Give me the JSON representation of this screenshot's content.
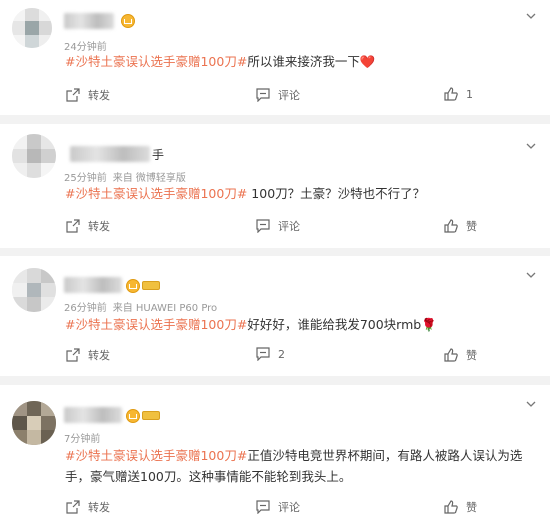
{
  "colors": {
    "topic": "#eb7350",
    "text": "#333333",
    "meta": "#999999",
    "card": "#ffffff",
    "background": "#f2f2f2"
  },
  "comments": [
    {
      "meta": "24分钟前",
      "source": "",
      "topic": "#沙特土豪误认选手豪赠100刀#",
      "text": "所以谁来接济我一下",
      "emoji": "❤️",
      "repost": "转发",
      "comment": "评论",
      "like": "1"
    },
    {
      "meta": "25分钟前",
      "source": "来自 微博轻享版",
      "topic": "#沙特土豪误认选手豪赠100刀#",
      "text": " 100刀？土豪？沙特也不行了？",
      "emoji": "",
      "repost": "转发",
      "comment": "评论",
      "like": "赞"
    },
    {
      "meta": "26分钟前",
      "source": "来自 HUAWEI P60 Pro",
      "topic": "#沙特土豪误认选手豪赠100刀#",
      "text": "好好好，谁能给我发700块rmb",
      "emoji": "🌹",
      "repost": "转发",
      "comment": "2",
      "like": "赞"
    },
    {
      "meta": "7分钟前",
      "source": "",
      "topic": "#沙特土豪误认选手豪赠100刀#",
      "text": "正值沙特电竞世界杯期间，有路人被路人误认为选手，豪气赠送100刀。这种事情能不能轮到我头上。",
      "emoji": "",
      "repost": "转发",
      "comment": "评论",
      "like": "赞"
    }
  ],
  "partial_name_fragment": "手"
}
